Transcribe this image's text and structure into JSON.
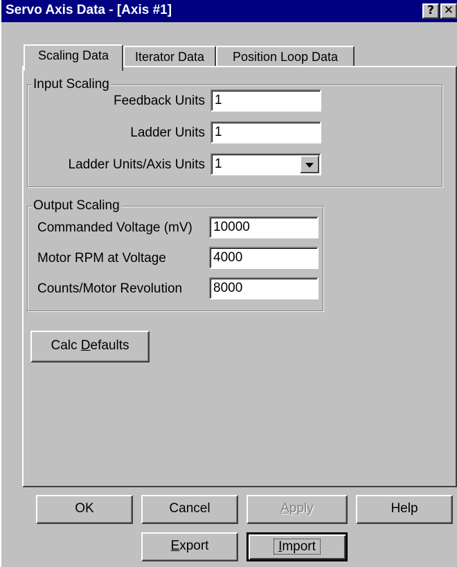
{
  "window": {
    "title": "Servo Axis Data - [Axis #1]",
    "help_glyph": "?",
    "close_glyph": "✕"
  },
  "tabs": [
    {
      "label": "Scaling Data",
      "active": true
    },
    {
      "label": "Iterator Data",
      "active": false
    },
    {
      "label": "Position Loop Data",
      "active": false
    }
  ],
  "input_scaling": {
    "legend": "Input Scaling",
    "feedback_units_label": "Feedback Units",
    "feedback_units_value": "1",
    "ladder_units_label": "Ladder Units",
    "ladder_units_value": "1",
    "ladder_axis_label": "Ladder Units/Axis Units",
    "ladder_axis_value": "1"
  },
  "output_scaling": {
    "legend": "Output Scaling",
    "commanded_voltage_label": "Commanded Voltage (mV)",
    "commanded_voltage_value": "10000",
    "motor_rpm_label": "Motor RPM at Voltage",
    "motor_rpm_value": "4000",
    "counts_label": "Counts/Motor Revolution",
    "counts_value": "8000"
  },
  "calc_defaults": {
    "pre": "Calc ",
    "mnemonic": "D",
    "post": "efaults"
  },
  "buttons": {
    "ok": "OK",
    "cancel": "Cancel",
    "apply_mnemonic": "A",
    "apply_rest": "pply",
    "help": "Help",
    "export_mnemonic": "E",
    "export_rest": "xport",
    "import_mnemonic": "I",
    "import_rest": "mport"
  }
}
